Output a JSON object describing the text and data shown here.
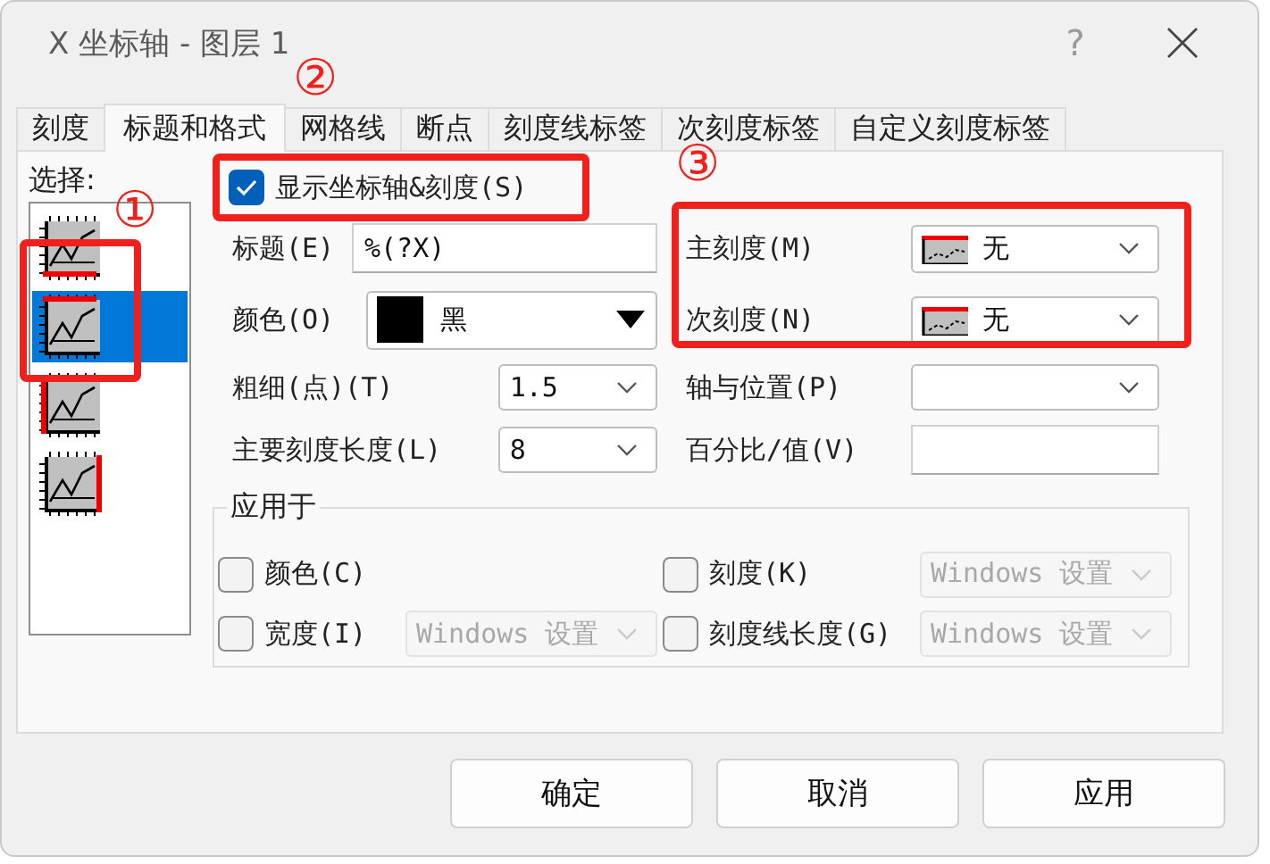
{
  "window": {
    "title": "X 坐标轴 - 图层 1",
    "help": "?"
  },
  "tabs": [
    {
      "label": "刻度",
      "selected": false
    },
    {
      "label": "标题和格式",
      "selected": true
    },
    {
      "label": "网格线",
      "selected": false
    },
    {
      "label": "断点",
      "selected": false
    },
    {
      "label": "刻度线标签",
      "selected": false
    },
    {
      "label": "次刻度标签",
      "selected": false
    },
    {
      "label": "自定义刻度标签",
      "selected": false
    }
  ],
  "selection": {
    "label": "选择:",
    "items": [
      {
        "kind": "bottom",
        "selected": false
      },
      {
        "kind": "top",
        "selected": true
      },
      {
        "kind": "left",
        "selected": false
      },
      {
        "kind": "right",
        "selected": false
      }
    ]
  },
  "show_axis": {
    "label": "显示坐标轴&刻度(S)",
    "checked": true
  },
  "left_fields": [
    {
      "kind": "text",
      "label": "标题(E)",
      "value": "%(?X)"
    },
    {
      "kind": "color",
      "label": "颜色(O)",
      "value": "黑"
    },
    {
      "kind": "combo",
      "label": "粗细(点)(T)",
      "value": "1.5"
    },
    {
      "kind": "combo",
      "label": "主要刻度长度(L)",
      "value": "8"
    }
  ],
  "right_fields": [
    {
      "kind": "tick",
      "label": "主刻度(M)",
      "value": "无"
    },
    {
      "kind": "tick",
      "label": "次刻度(N)",
      "value": "无"
    },
    {
      "kind": "combo",
      "label": "轴与位置(P)"
    },
    {
      "kind": "text",
      "label": "百分比/值(V)"
    }
  ],
  "apply_to": {
    "label": "应用于",
    "options": [
      {
        "label": "颜色(C)",
        "checked": false
      },
      {
        "label": "刻度(K)",
        "checked": false,
        "select": {
          "value": "Windows 设置",
          "disabled": true
        }
      },
      {
        "label": "宽度(I)",
        "checked": false,
        "select": {
          "value": "Windows 设置",
          "disabled": true
        }
      },
      {
        "label": "刻度线长度(G)",
        "checked": false,
        "select": {
          "value": "Windows 设置",
          "disabled": true
        }
      }
    ]
  },
  "buttons": [
    "确定",
    "取消",
    "应用"
  ],
  "annotations": [
    {
      "number": "①"
    },
    {
      "number": "②"
    },
    {
      "number": "③"
    }
  ]
}
